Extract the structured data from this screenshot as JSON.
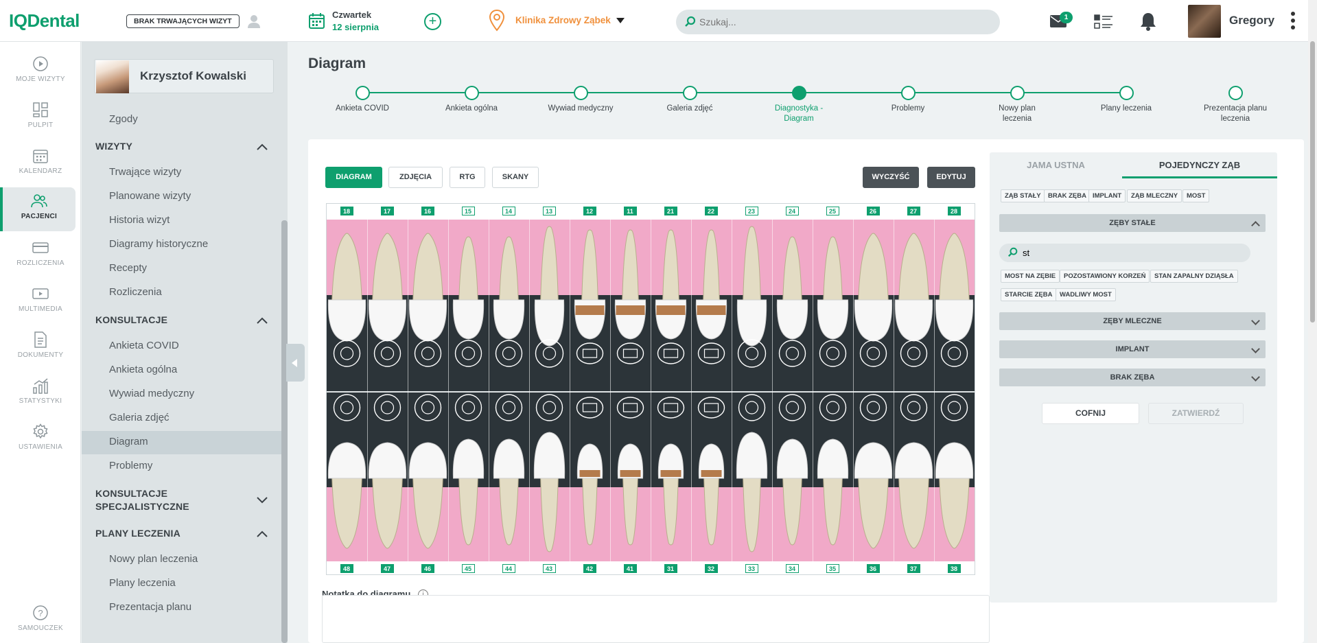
{
  "app": {
    "logo": "IQDental"
  },
  "topbar": {
    "no_visits": "BRAK TRWAJĄCYCH WIZYT",
    "day": "Czwartek",
    "date": "12 sierpnia",
    "clinic": "Klinika Zdrowy Ząbek",
    "search_placeholder": "Szukaj...",
    "mail_count": "1",
    "user": "Gregory"
  },
  "nav": {
    "items": [
      {
        "label": "MOJE WIZYTY",
        "icon": "play-circle-icon"
      },
      {
        "label": "PULPIT",
        "icon": "dashboard-icon"
      },
      {
        "label": "KALENDARZ",
        "icon": "calendar-icon"
      },
      {
        "label": "PACJENCI",
        "icon": "patients-icon"
      },
      {
        "label": "ROZLICZENIA",
        "icon": "card-icon"
      },
      {
        "label": "MULTIMEDIA",
        "icon": "video-icon"
      },
      {
        "label": "DOKUMENTY",
        "icon": "document-icon"
      },
      {
        "label": "STATYSTYKI",
        "icon": "stats-icon"
      },
      {
        "label": "USTAWIENIA",
        "icon": "gear-icon"
      }
    ],
    "help": "SAMOUCZEK"
  },
  "sidebar": {
    "patient": "Krzysztof Kowalski",
    "top_item": "Zgody",
    "sections": [
      {
        "title": "WIZYTY",
        "items": [
          "Trwające wizyty",
          "Planowane wizyty",
          "Historia wizyt",
          "Diagramy historyczne",
          "Recepty",
          "Rozliczenia"
        ]
      },
      {
        "title": "KONSULTACJE",
        "items": [
          "Ankieta COVID",
          "Ankieta ogólna",
          "Wywiad medyczny",
          "Galeria zdjęć",
          "Diagram",
          "Problemy"
        ]
      },
      {
        "title_line1": "KONSULTACJE",
        "title_line2": "SPECJALISTYCZNE"
      },
      {
        "title": "PLANY LECZENIA",
        "items": [
          "Nowy plan leczenia",
          "Plany leczenia",
          "Prezentacja planu"
        ]
      }
    ]
  },
  "page": {
    "title": "Diagram"
  },
  "steps": [
    {
      "l1": "Ankieta COVID",
      "l2": ""
    },
    {
      "l1": "Ankieta ogólna",
      "l2": ""
    },
    {
      "l1": "Wywiad medyczny",
      "l2": ""
    },
    {
      "l1": "Galeria zdjęć",
      "l2": ""
    },
    {
      "l1": "Diagnostyka -",
      "l2": "Diagram"
    },
    {
      "l1": "Problemy",
      "l2": ""
    },
    {
      "l1": "Nowy plan",
      "l2": "leczenia"
    },
    {
      "l1": "Plany leczenia",
      "l2": ""
    },
    {
      "l1": "Prezentacja planu",
      "l2": "leczenia"
    }
  ],
  "toolbar": {
    "diagram": "DIAGRAM",
    "photos": "ZDJĘCIA",
    "rtg": "RTG",
    "scans": "SKANY",
    "clear": "WYCZYŚĆ",
    "edit": "EDYTUJ"
  },
  "teeth": {
    "upper": [
      "18",
      "17",
      "16",
      "15",
      "14",
      "13",
      "12",
      "11",
      "21",
      "22",
      "23",
      "24",
      "25",
      "26",
      "27",
      "28"
    ],
    "lower": [
      "48",
      "47",
      "46",
      "45",
      "44",
      "43",
      "42",
      "41",
      "31",
      "32",
      "33",
      "34",
      "35",
      "36",
      "37",
      "38"
    ],
    "highlighted_upper": [
      "18",
      "17",
      "16",
      "12",
      "11",
      "21",
      "22",
      "26",
      "27",
      "28"
    ],
    "highlighted_lower": [
      "48",
      "47",
      "46",
      "42",
      "41",
      "31",
      "32",
      "36",
      "37",
      "38"
    ]
  },
  "note": {
    "label": "Notatka do diagramu",
    "info": "i"
  },
  "right": {
    "tab1": "JAMA USTNA",
    "tab2": "POJEDYNCZY ZĄB",
    "chips": [
      "ZĄB STAŁY",
      "BRAK ZĘBA",
      "IMPLANT",
      "ZĄB MLECZNY",
      "MOST"
    ],
    "acc1": "ZĘBY STAŁE",
    "search_value": "st",
    "results": [
      "MOST NA ZĘBIE",
      "POZOSTAWIONY KORZEŃ",
      "STAN ZAPALNY DZIĄSŁA",
      "STARCIE ZĘBA",
      "WADLIWY MOST"
    ],
    "acc2": "ZĘBY MLECZNE",
    "acc3": "IMPLANT",
    "acc4": "BRAK ZĘBA",
    "back": "COFNIJ",
    "confirm": "ZATWIERDŹ"
  },
  "colors": {
    "accent": "#0e9f6e",
    "gum": "#f1a9c8",
    "dark": "#2c3439",
    "clinic": "#f0903c"
  }
}
